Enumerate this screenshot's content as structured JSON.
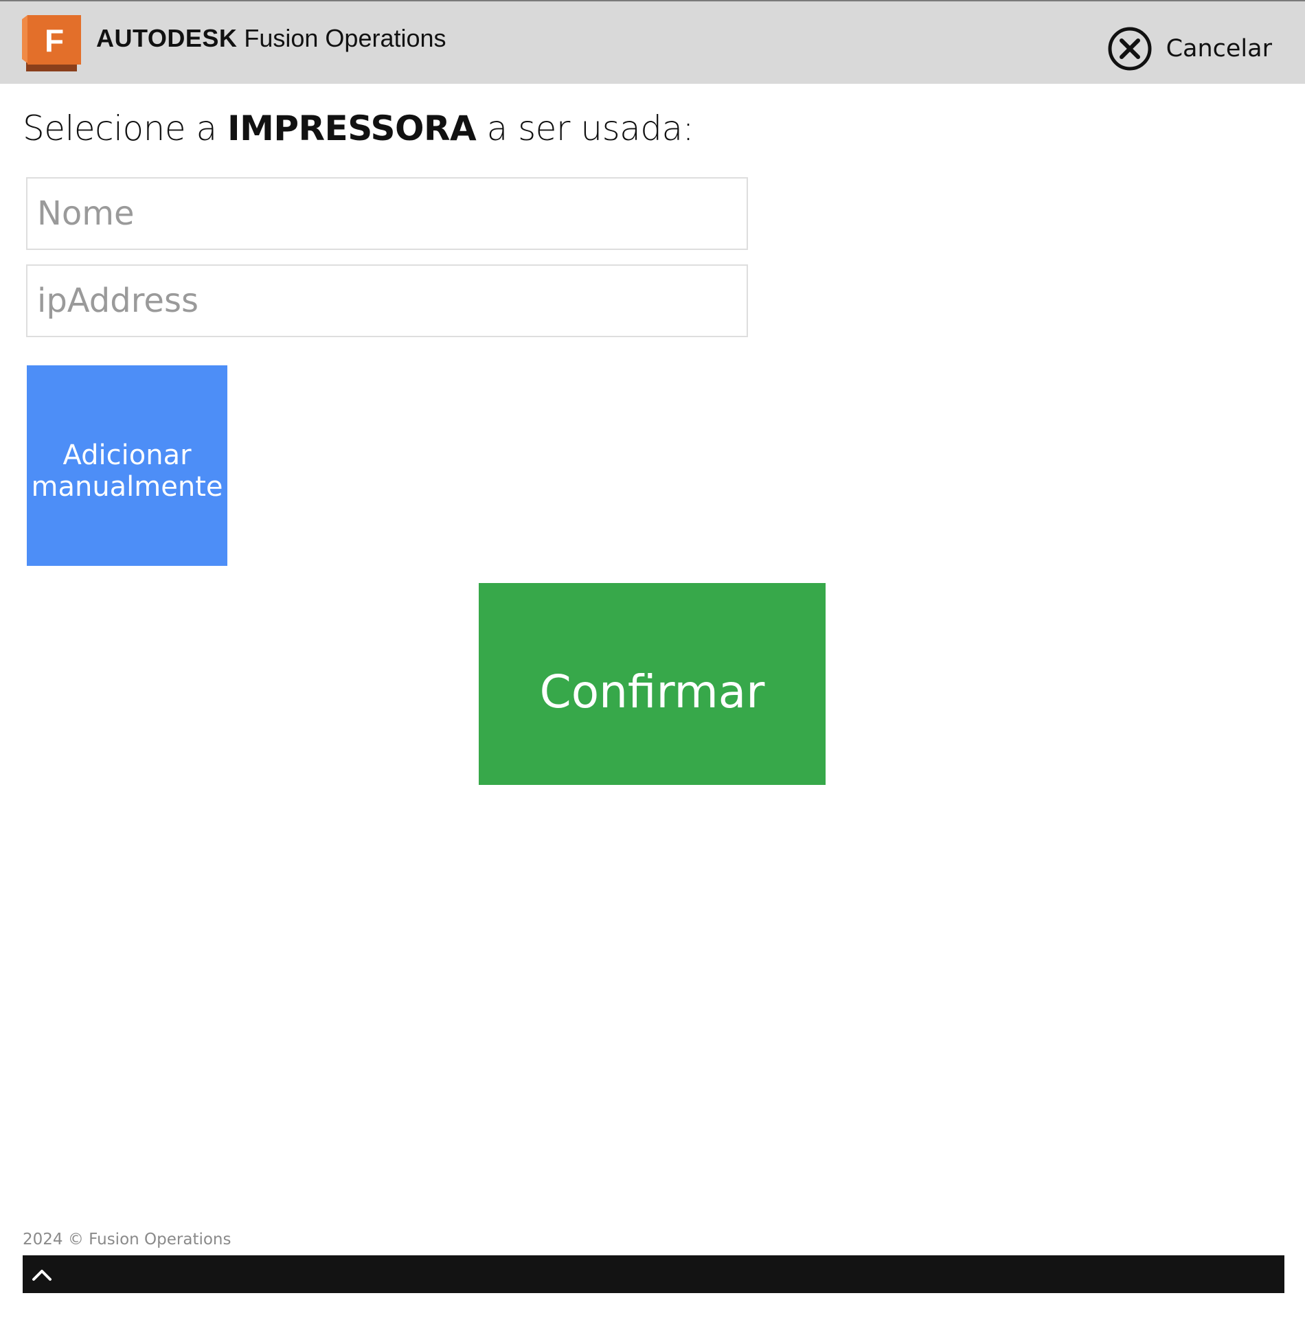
{
  "header": {
    "brand_name": "AUTODESK",
    "product_name": "Fusion Operations",
    "logo_letter": "F",
    "logo_icon": "fusion-logo-icon",
    "cancel_label": "Cancelar",
    "cancel_icon": "close-circle-icon"
  },
  "heading": {
    "prefix": "Selecione a",
    "emphasis": "IMPRESSORA",
    "suffix": "a ser usada:"
  },
  "form": {
    "name_placeholder": "Nome",
    "name_value": "",
    "ip_placeholder": "ipAddress",
    "ip_value": ""
  },
  "buttons": {
    "manual_line1": "Adicionar",
    "manual_line2": "manualmente",
    "confirm_label": "Confirmar"
  },
  "footer": {
    "copyright": "2024 © Fusion Operations",
    "scroll_top_icon": "chevron-up-icon"
  },
  "colors": {
    "header_bg": "#d9d9d9",
    "logo_orange": "#e8742c",
    "manual_button": "#4d8ef7",
    "confirm_button": "#37a84a",
    "footer_bar": "#131313"
  }
}
